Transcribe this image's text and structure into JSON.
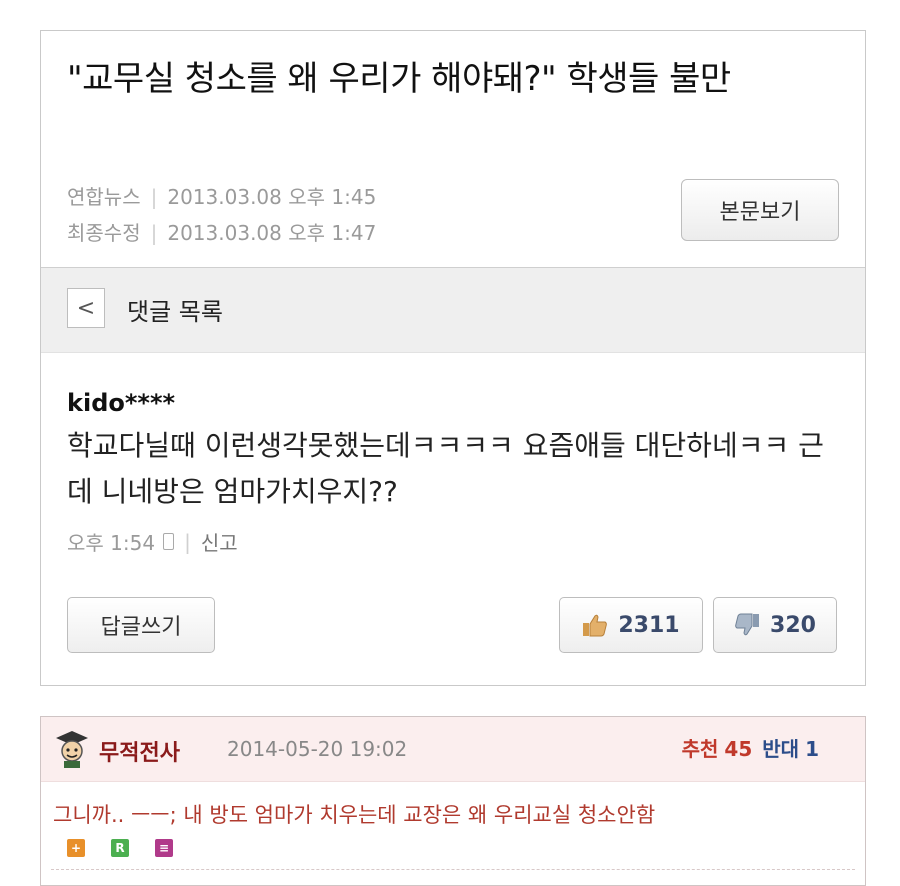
{
  "article": {
    "headline": "\"교무실 청소를 왜 우리가 해야돼?\" 학생들 불만",
    "source_label": "연합뉴스",
    "published": "2013.03.08 오후 1:45",
    "modified_label": "최종수정",
    "modified": "2013.03.08 오후 1:47",
    "view_button": "본문보기"
  },
  "comment_list": {
    "back_icon": "chevron-left-icon",
    "title": "댓글 목록"
  },
  "comment": {
    "user": "kido****",
    "text": "학교다닐때 이런생각못했는데ㅋㅋㅋㅋ 요즘애들 대단하네ㅋㅋ 근데 니네방은 엄마가치우지??",
    "time": "오후 1:54",
    "device_icon": "phone-icon",
    "report": "신고",
    "reply_button": "답글쓰기",
    "likes": "2311",
    "dislikes": "320",
    "colors": {
      "like_icon": "#d49a4a",
      "dislike_icon": "#8a9bb0"
    }
  },
  "comment2": {
    "user": "무적전사",
    "date": "2014-05-20 19:02",
    "recommend_label": "추천",
    "recommend": "45",
    "oppose_label": "반대",
    "oppose": "1",
    "text": "그니까.. ㅡㅡ; 내 방도 엄마가 치우는데 교장은 왜 우리교실 청소안함",
    "badges": [
      {
        "letter": "+",
        "color": "#e8902a"
      },
      {
        "letter": "R",
        "color": "#4caf50"
      },
      {
        "letter": "≡",
        "color": "#b03a8a"
      }
    ]
  }
}
